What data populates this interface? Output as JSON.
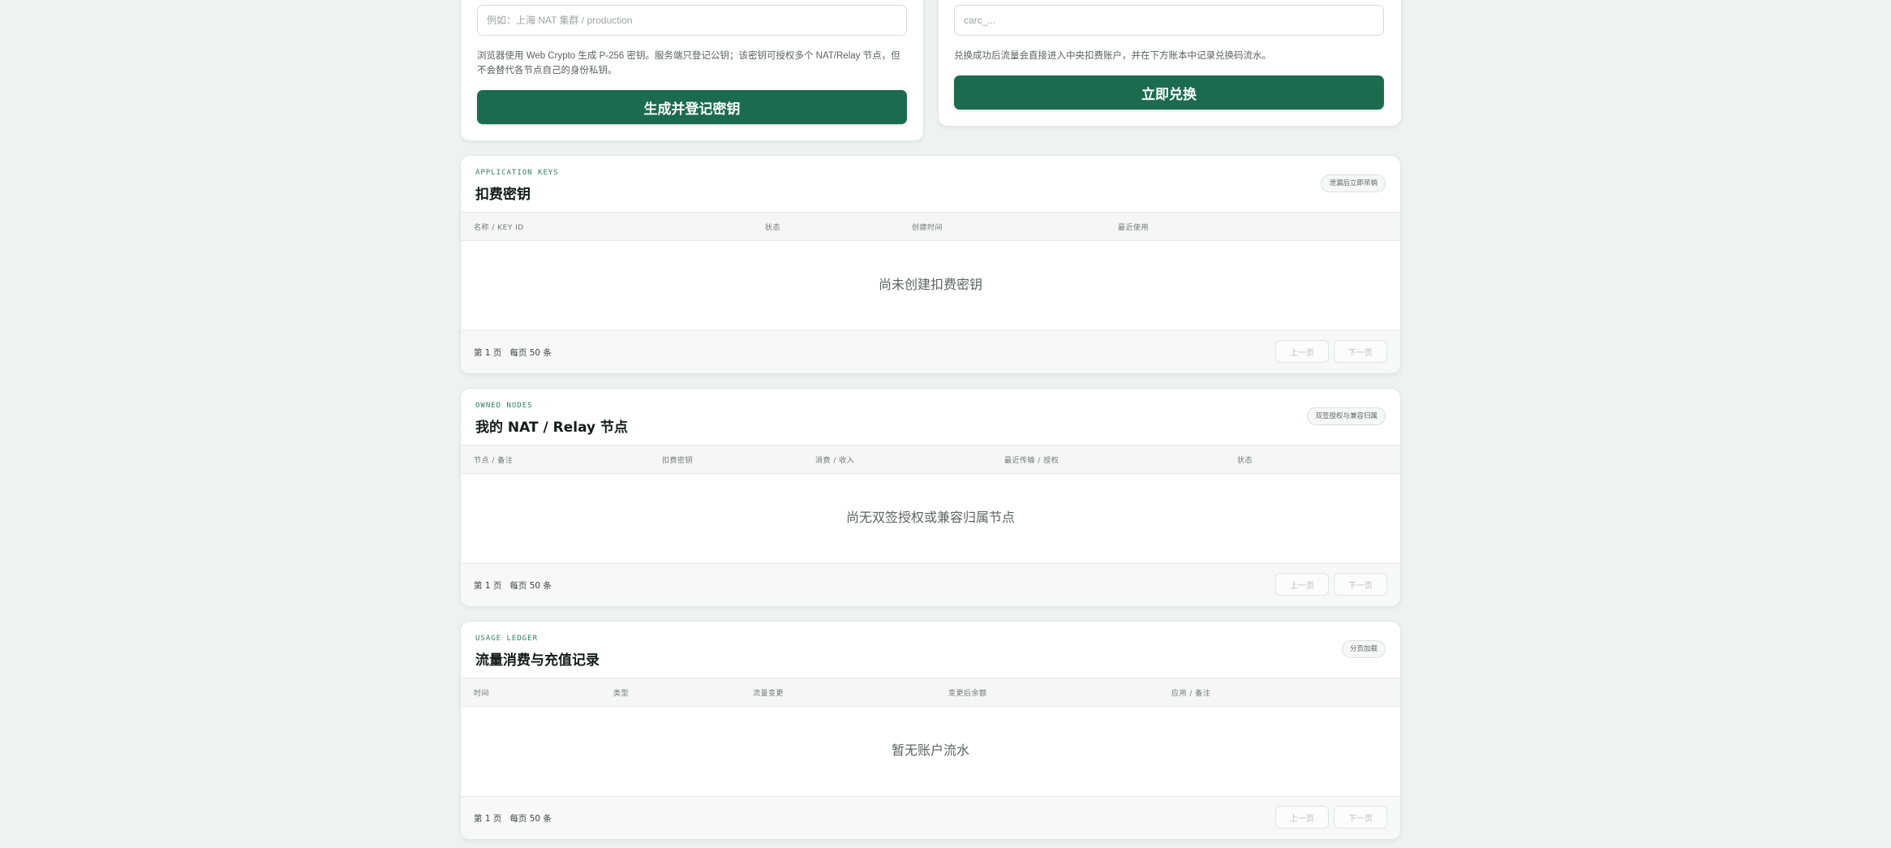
{
  "keygen": {
    "name_placeholder": "例如：上海 NAT 集群 / production",
    "help": "浏览器使用 Web Crypto 生成 P-256 密钥。服务端只登记公钥；该密钥可授权多个 NAT/Relay 节点，但不会替代各节点自己的身份私钥。",
    "button": "生成并登记密钥"
  },
  "redeem": {
    "code_placeholder": "carc_...",
    "help": "兑换成功后流量会直接进入中央扣费账户，并在下方账本中记录兑换码流水。",
    "button": "立即兑换"
  },
  "pager_labels": {
    "page": "第 1 页",
    "per_page": "每页 50 条",
    "prev": "上一页",
    "next": "下一页"
  },
  "sections": {
    "keys": {
      "eyebrow": "APPLICATION KEYS",
      "title": "扣费密钥",
      "pill": "泄漏后立即吊销",
      "columns": [
        "名称 / KEY ID",
        "状态",
        "创建时间",
        "最近使用"
      ],
      "empty": "尚未创建扣费密钥"
    },
    "nodes": {
      "eyebrow": "OWNED NODES",
      "title": "我的 NAT / Relay 节点",
      "pill": "双签授权与兼容归属",
      "columns": [
        "节点 / 备注",
        "扣费密钥",
        "消费 / 收入",
        "最近传输 / 授权",
        "状态"
      ],
      "empty": "尚无双签授权或兼容归属节点"
    },
    "ledger": {
      "eyebrow": "USAGE LEDGER",
      "title": "流量消费与充值记录",
      "pill": "分页加载",
      "columns": [
        "时间",
        "类型",
        "流量变更",
        "变更后余额",
        "应用 / 备注"
      ],
      "empty": "暂无账户流水"
    }
  }
}
